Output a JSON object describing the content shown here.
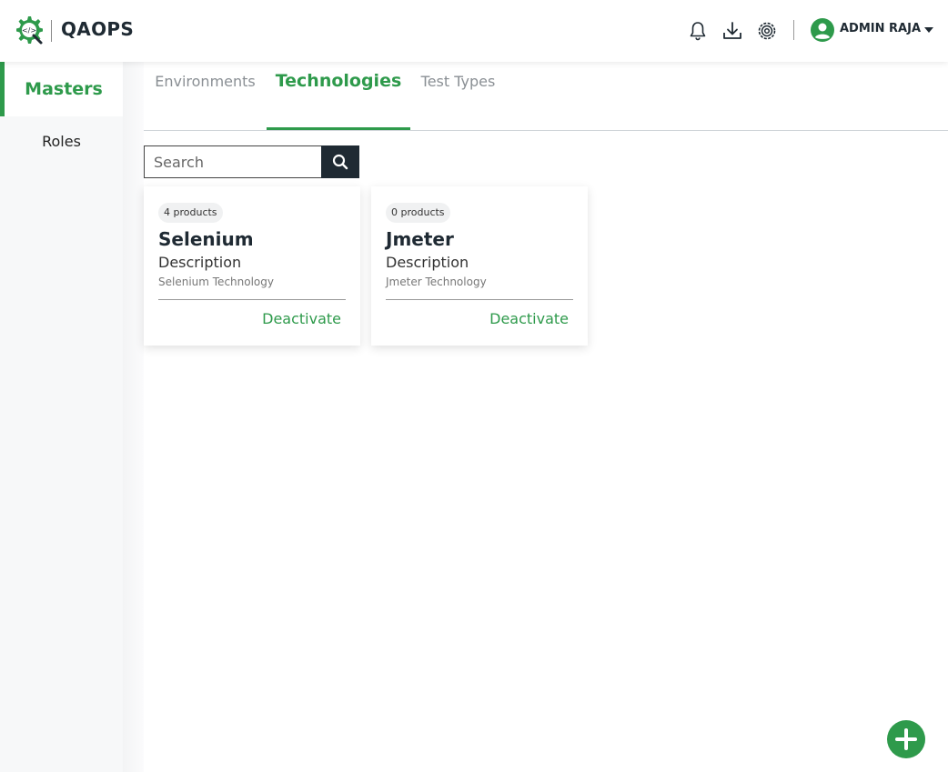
{
  "app": {
    "brand": "QAOPS",
    "logo_icon": "gear-code-icon"
  },
  "topbar": {
    "notification_icon": "bell-icon",
    "download_icon": "download-icon",
    "settings_icon": "settings-gear-icon",
    "user": {
      "name": "ADMIN RAJA",
      "avatar_icon": "user-circle-icon"
    }
  },
  "sidebar": {
    "items": [
      {
        "label": "Masters",
        "active": true
      },
      {
        "label": "Roles",
        "active": false
      }
    ]
  },
  "tabs": [
    {
      "label": "Environments",
      "active": false
    },
    {
      "label": "Technologies",
      "active": true
    },
    {
      "label": "Test Types",
      "active": false
    }
  ],
  "search": {
    "placeholder": "Search",
    "value": ""
  },
  "cards": [
    {
      "badge": "4 products",
      "title": "Selenium",
      "description_label": "Description",
      "description": "Selenium Technology",
      "action": "Deactivate"
    },
    {
      "badge": "0 products",
      "title": "Jmeter",
      "description_label": "Description",
      "description": "Jmeter Technology",
      "action": "Deactivate"
    }
  ],
  "colors": {
    "accent": "#2e9a4b",
    "dark": "#1f2a33"
  }
}
